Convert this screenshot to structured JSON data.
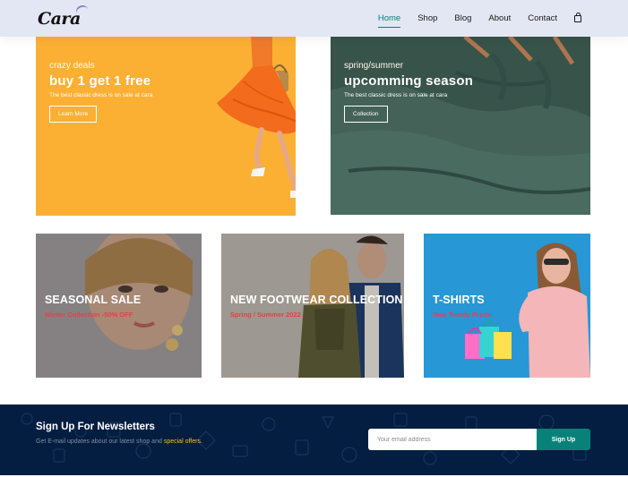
{
  "header": {
    "logo": "Cara",
    "nav": [
      "Home",
      "Shop",
      "Blog",
      "About",
      "Contact"
    ],
    "active": "Home"
  },
  "banners": {
    "deals": {
      "small": "crazy deals",
      "big": "buy 1 get 1 free",
      "sub": "The best classic dress is on sale at cara",
      "button": "Learn More"
    },
    "spring": {
      "small": "spring/summer",
      "big": "upcomming season",
      "sub": "The best classic dress is on sale at cara",
      "button": "Collection"
    }
  },
  "small_banners": [
    {
      "title": "SEASONAL SALE",
      "sub": "Winter Collection -50% OFF"
    },
    {
      "title": "NEW FOOTWEAR COLLECTION",
      "sub": "Spring / Summer 2022"
    },
    {
      "title": "T-SHIRTS",
      "sub": "New Trendy Prints"
    }
  ],
  "newsletter": {
    "title": "Sign Up For Newsletters",
    "desc_prefix": "Get E-mail updates about our latest shop and",
    "desc_highlight": "special offers.",
    "placeholder": "Your email address",
    "button": "Sign Up"
  },
  "colors": {
    "accent": "#088178",
    "header_bg": "#e3e6f3",
    "newsletter_bg": "#041e42",
    "highlight": "#ffbd27",
    "sale_red": "#ec3d47"
  }
}
